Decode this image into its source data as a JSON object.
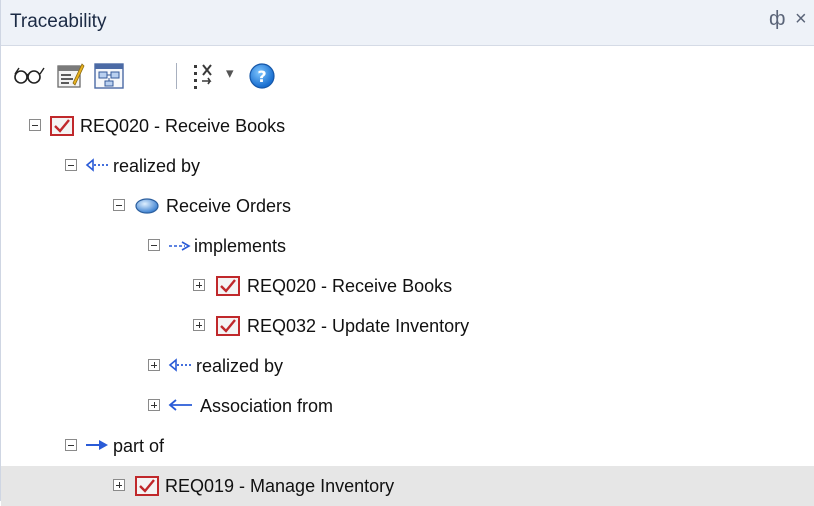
{
  "window": {
    "title": "Traceability",
    "pin_glyph": "ф",
    "close_glyph": "×"
  },
  "toolbar": {
    "buttons": [
      {
        "icon": "glasses-icon"
      },
      {
        "icon": "properties-icon"
      },
      {
        "icon": "diagram-icon"
      },
      {
        "icon": "filter-options-icon"
      },
      {
        "icon": "dropdown-arrow-icon"
      },
      {
        "icon": "help-icon"
      }
    ],
    "dropdown_glyph": "▾",
    "help_glyph": "?"
  },
  "colors": {
    "title_bar": "#eef2f8",
    "requirement_icon": "#c0282b",
    "realize_arrow": "#2a5bd7",
    "use_case": "#3a7fd0",
    "selected_row": "#e6e6e6"
  },
  "tree": [
    {
      "label": "REQ020 - Receive Books",
      "icon": "requirement-icon",
      "expanded": true
    },
    {
      "label": "realized by",
      "icon": "realization-arrow-icon",
      "expanded": true
    },
    {
      "label": "Receive Orders",
      "icon": "use-case-icon",
      "expanded": true
    },
    {
      "label": "implements",
      "icon": "dependency-arrow-icon",
      "expanded": true
    },
    {
      "label": "REQ020 - Receive Books",
      "icon": "requirement-icon",
      "expanded": false
    },
    {
      "label": "REQ032 - Update Inventory",
      "icon": "requirement-icon",
      "expanded": false
    },
    {
      "label": "realized by",
      "icon": "realization-arrow-icon",
      "expanded": false
    },
    {
      "label": "Association from",
      "icon": "association-arrow-icon",
      "expanded": false
    },
    {
      "label": "part of",
      "icon": "aggregation-arrow-icon",
      "expanded": true
    },
    {
      "label": "REQ019 - Manage Inventory",
      "icon": "requirement-icon",
      "expanded": false,
      "selected": true
    }
  ]
}
